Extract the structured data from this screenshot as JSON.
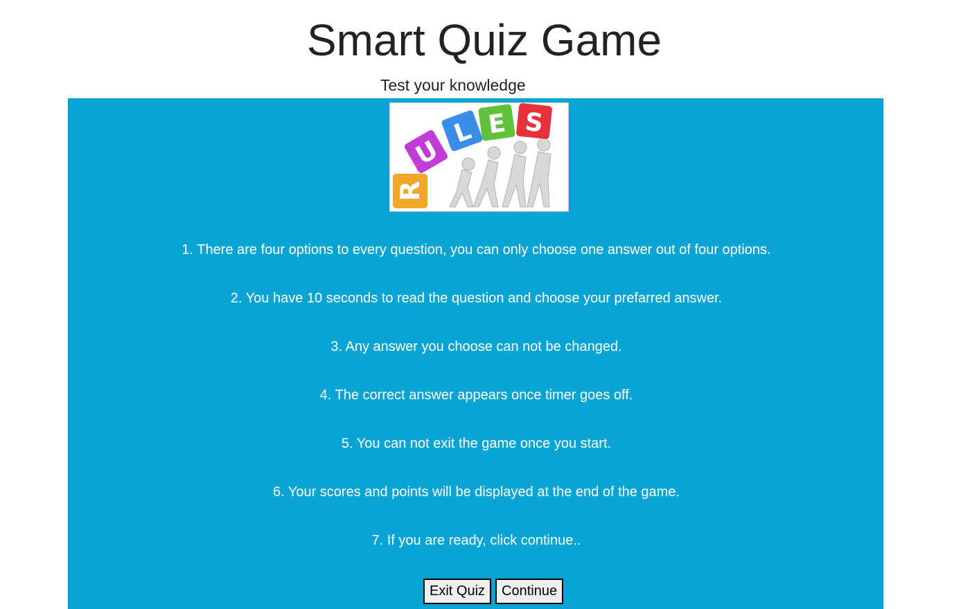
{
  "header": {
    "title": "Smart Quiz Game",
    "subtitle": "Test your knowledge"
  },
  "rules_image": {
    "letters": [
      "R",
      "U",
      "L",
      "E",
      "S"
    ],
    "letter_colors": [
      "#f4a62a",
      "#c23bd8",
      "#3a8de8",
      "#5fc23a",
      "#e8323a"
    ]
  },
  "rules": [
    "1. There are four options to every question, you can only choose one answer out of four options.",
    "2. You have 10 seconds to read the question and choose your prefarred answer.",
    "3. Any answer you choose can not be changed.",
    "4. The correct answer appears once timer goes off.",
    "5. You can not exit the game once you start.",
    "6. Your scores and points will be displayed at the end of the game.",
    "7. If you are ready, click continue.."
  ],
  "buttons": {
    "exit_label": "Exit Quiz",
    "continue_label": "Continue"
  },
  "colors": {
    "panel": "#07a4d4",
    "text_on_panel": "#ffffff"
  }
}
